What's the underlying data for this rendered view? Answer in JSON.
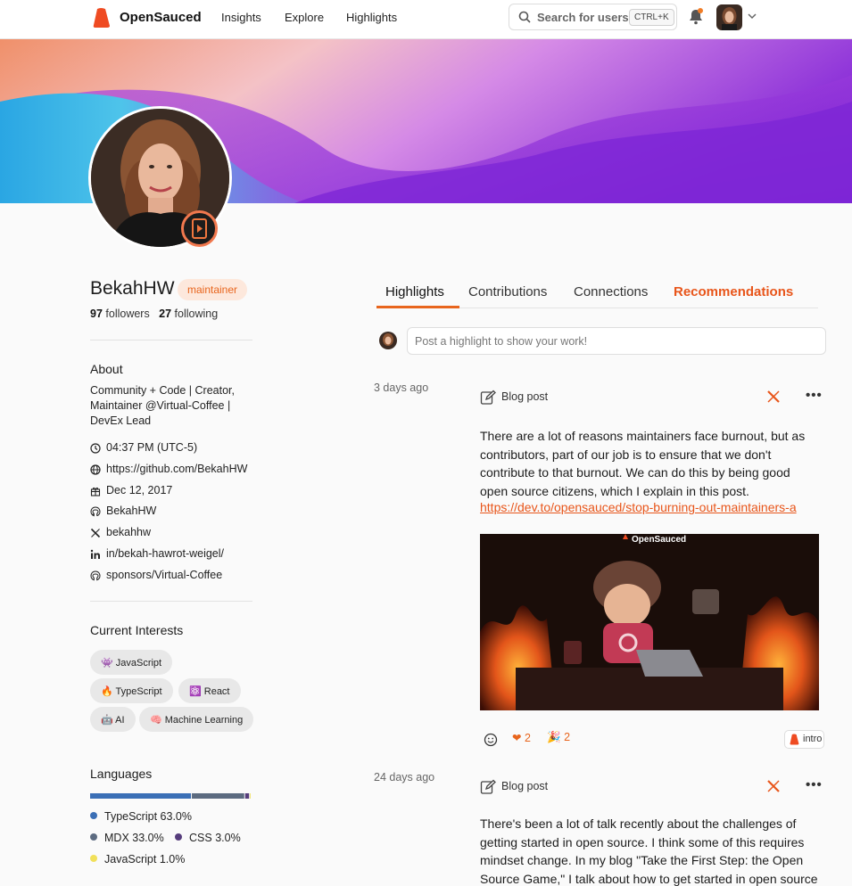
{
  "nav": {
    "brand": "OpenSauced",
    "links": [
      "Insights",
      "Explore",
      "Highlights"
    ],
    "search_placeholder": "Search for users",
    "search_shortcut": "CTRL+K"
  },
  "profile": {
    "name": "BekahHW",
    "role": "maintainer",
    "followers_count": "97",
    "followers_label": "followers",
    "following_count": "27",
    "following_label": "following",
    "about_title": "About",
    "bio": "Community + Code | Creator, Maintainer @Virtual-Coffee | DevEx Lead",
    "time": "04:37 PM (UTC-5)",
    "website": "https://github.com/BekahHW",
    "joined": "Dec 12, 2017",
    "github": "BekahHW",
    "twitter": "bekahhw",
    "linkedin": "in/bekah-hawrot-weigel/",
    "sponsors": "sponsors/Virtual-Coffee"
  },
  "interests": {
    "title": "Current Interests",
    "items": [
      "👾 JavaScript",
      "🔥 TypeScript",
      "⚛️ React",
      "🤖 AI",
      "🧠 Machine Learning"
    ]
  },
  "languages": {
    "title": "Languages",
    "items": [
      {
        "name": "TypeScript",
        "percent": "63.0%",
        "value": 63.0,
        "color": "#3b6fb6"
      },
      {
        "name": "MDX",
        "percent": "33.0%",
        "value": 33.0,
        "color": "#5c6b80"
      },
      {
        "name": "CSS",
        "percent": "3.0%",
        "value": 3.0,
        "color": "#563d7c"
      },
      {
        "name": "JavaScript",
        "percent": "1.0%",
        "value": 1.0,
        "color": "#f1e05a"
      }
    ]
  },
  "tabs": [
    "Highlights",
    "Contributions",
    "Connections",
    "Recommendations"
  ],
  "composer_placeholder": "Post a highlight to show your work!",
  "posts": [
    {
      "ago": "3 days ago",
      "type": "Blog post",
      "text": "There are a lot of reasons maintainers face burnout, but as contributors, part of our job is to ensure that we don't contribute to that burnout. We can do this by being good open source citizens, which I explain in this post.",
      "link": "https://dev.to/opensauced/stop-burning-out-maintainers-a",
      "image_brand": "OpenSauced",
      "heart_count": "2",
      "tada_count": "2",
      "repo_tag": "intro"
    },
    {
      "ago": "24 days ago",
      "type": "Blog post",
      "text": "There's been a lot of talk recently about the challenges of getting started in open source. I think some of this requires mindset change. In my blog \"Take the First Step: the Open Source Game,\" I talk about how to get started in open source"
    }
  ]
}
